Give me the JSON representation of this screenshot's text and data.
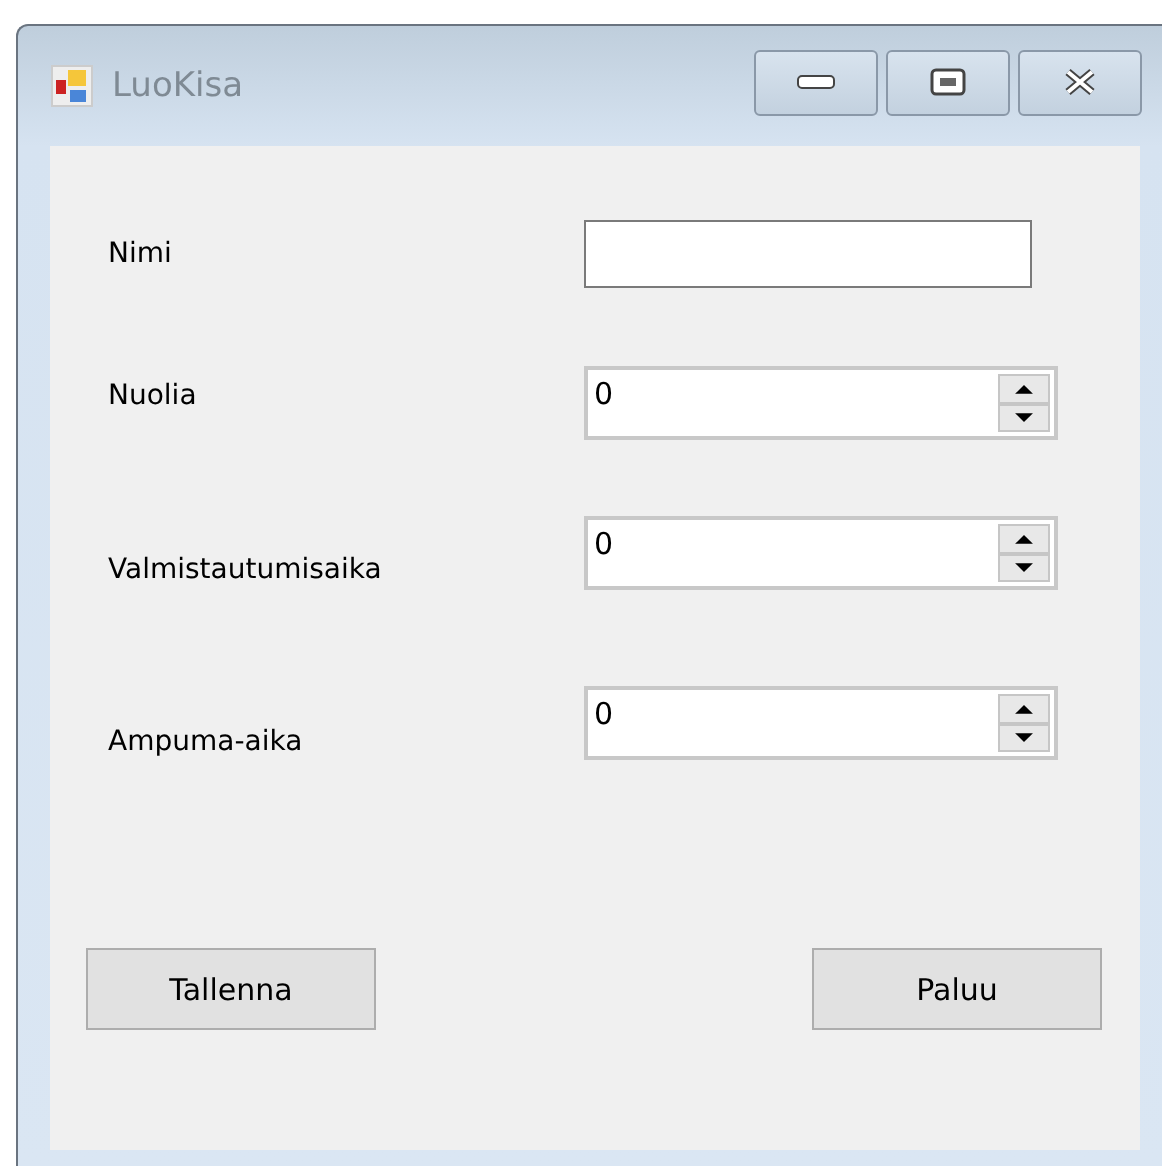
{
  "window": {
    "title": "LuoKisa"
  },
  "fields": [
    {
      "label": "Nimi",
      "kind": "text"
    },
    {
      "label": "Nuolia",
      "kind": "number",
      "value": "0"
    },
    {
      "label": "Valmistautumisaika",
      "kind": "number",
      "value": "0"
    },
    {
      "label": "Ampuma-aika",
      "kind": "number",
      "value": "0"
    }
  ],
  "buttons": [
    "Tallenna",
    "Paluu"
  ]
}
